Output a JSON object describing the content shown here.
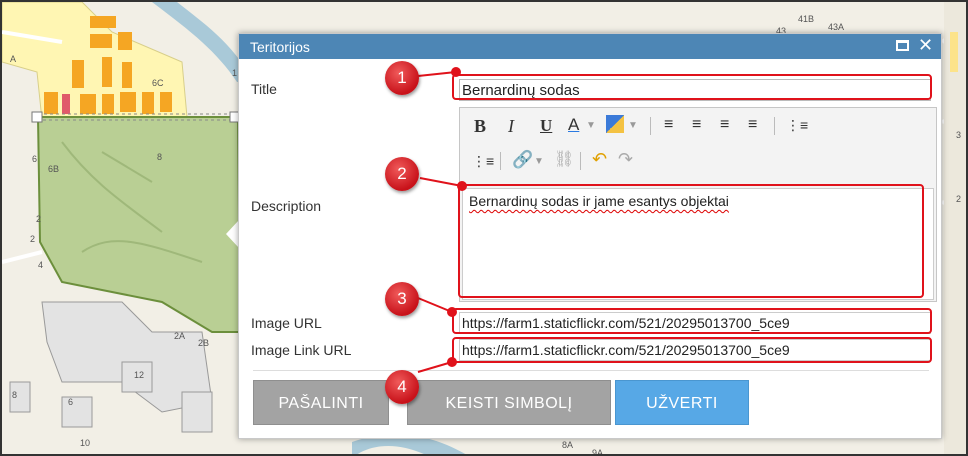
{
  "popup": {
    "title": "Teritorijos",
    "maximize_icon": "maximize-icon",
    "close_icon": "close-icon"
  },
  "form": {
    "title_label": "Title",
    "title_value": "Bernardinų sodas",
    "description_label": "Description",
    "description_value": "Bernardinų sodas ir jame esantys objektai",
    "image_url_label": "Image URL",
    "image_url_value": "https://farm1.staticflickr.com/521/20295013700_5ce9",
    "image_link_url_label": "Image Link URL",
    "image_link_url_value": "https://farm1.staticflickr.com/521/20295013700_5ce9"
  },
  "toolbar": {
    "bold": "B",
    "italic": "I",
    "underline": "U",
    "font_color": "A",
    "font_color_icon": "font-color-icon",
    "highlight_icon": "highlight-color-icon",
    "align_left_icon": "align-left-icon",
    "align_center_icon": "align-center-icon",
    "align_right_icon": "align-right-icon",
    "justify_icon": "justify-icon",
    "ordered_list_icon": "ordered-list-icon",
    "unordered_list_icon": "unordered-list-icon",
    "link_icon": "link-icon",
    "unlink_icon": "unlink-icon",
    "undo_icon": "undo-icon",
    "redo_icon": "redo-icon"
  },
  "buttons": {
    "delete": "PAŠALINTI",
    "change_symbol": "KEISTI SIMBOLĮ",
    "close": "UŽVERTI"
  },
  "callouts": [
    "1",
    "2",
    "3",
    "4"
  ],
  "map_labels": {
    "l1": "6C",
    "l2": "6B",
    "l3": "8",
    "l4": "4",
    "l5": "2",
    "l6": "2A",
    "l7": "2B",
    "l8": "12",
    "l9": "8",
    "l10": "6",
    "l11": "10",
    "l12": "41B",
    "l13": "43A",
    "l14": "43",
    "l15": "8A",
    "l16": "9A",
    "l17": "A",
    "l18": "3",
    "l19": "2",
    "l20": "2",
    "l21": "6",
    "l22": "1"
  },
  "colors": {
    "titlebar": "#4d86b5",
    "button_gray": "#a3a3a3",
    "button_blue": "#57a8e6",
    "callout_red": "#e0121b",
    "park_green": "#b9cf94",
    "building_orange": "#f5a623",
    "river_blue": "#a9c9d8"
  }
}
